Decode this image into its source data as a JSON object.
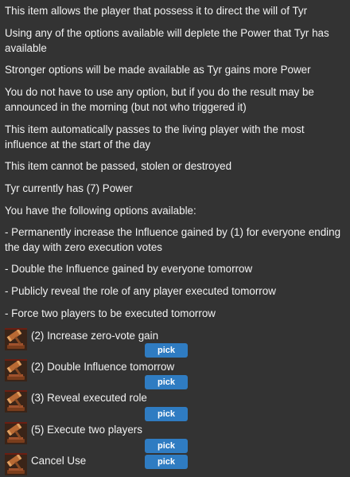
{
  "description": [
    "This item allows the player that possess it to direct the will of Tyr",
    "Using any of the options available will deplete the Power that Tyr has available",
    "Stronger options will be made available as Tyr gains more Power",
    "You do not have to use any option, but if you do the result may be announced in the morning (but not who triggered it)",
    "This item automatically passes to the living player with the most influence at the start of the day",
    "This item cannot be passed, stolen or destroyed",
    "Tyr currently has (7) Power",
    "You have the following options available:",
    "- Permanently increase the Influence gained by (1) for everyone ending the day with zero execution votes",
    "- Double the Influence gained by everyone tomorrow",
    "- Publicly reveal the role of any player executed tomorrow",
    "- Force two players to be executed tomorrow"
  ],
  "options": [
    {
      "label": "(2) Increase zero-vote gain",
      "button": "pick",
      "icon": "gavel-icon"
    },
    {
      "label": "(2) Double Influence tomorrow",
      "button": "pick",
      "icon": "gavel-icon"
    },
    {
      "label": "(3) Reveal executed role",
      "button": "pick",
      "icon": "gavel-icon"
    },
    {
      "label": "(5) Execute two players",
      "button": "pick",
      "icon": "gavel-icon"
    },
    {
      "label": "Cancel Use",
      "button": "pick",
      "icon": "gavel-icon"
    }
  ],
  "colors": {
    "background": "#333333",
    "text": "#f2f2f2",
    "button": "#2f7cc2"
  }
}
